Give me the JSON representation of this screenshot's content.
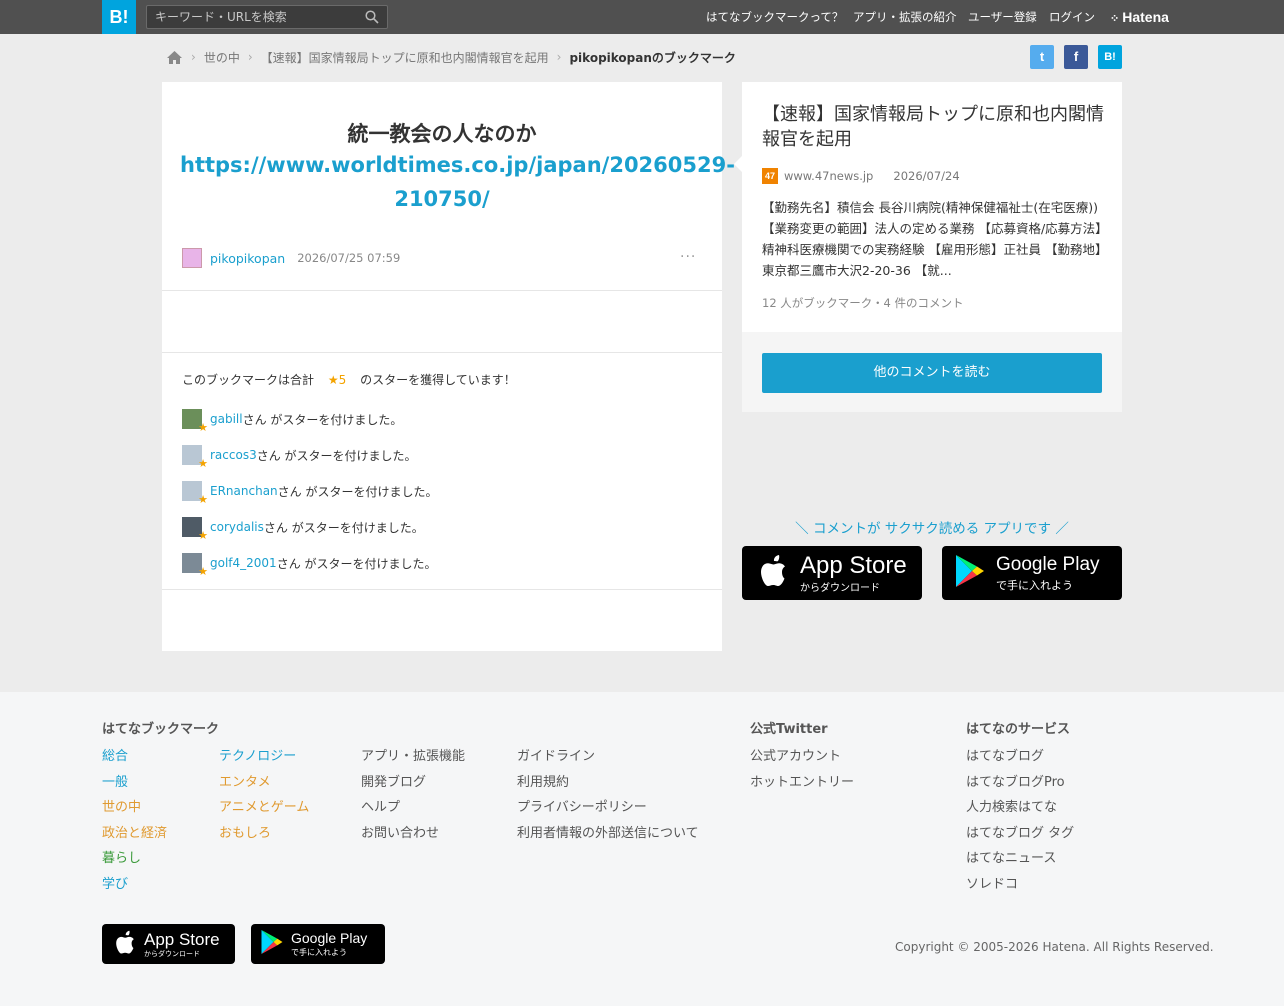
{
  "header": {
    "logo": "B!",
    "search_placeholder": "キーワード・URLを検索",
    "nav": [
      "はてなブックマークって？",
      "アプリ・拡張の紹介",
      "ユーザー登録",
      "ログイン"
    ],
    "brand": "Hatena"
  },
  "breadcrumb": {
    "items": [
      "世の中",
      "【速報】国家情報局トップに原和也内閣情報官を起用",
      "pikopikopanのブックマーク"
    ]
  },
  "share": {
    "twitter": "t",
    "facebook": "f",
    "hatena": "B!"
  },
  "comment": {
    "title": "統一教会の人なのか",
    "link": "https://www.worldtimes.co.jp/japan/20260529-210750/",
    "user": "pikopikopan",
    "date": "2026/07/25 07:59",
    "more": "···"
  },
  "stars": {
    "summary_prefix": "このブックマークは合計",
    "summary_count": "★5",
    "summary_suffix": "のスターを獲得しています！",
    "suffix": "さん がスターを付けました。",
    "entries": [
      {
        "user": "gabill"
      },
      {
        "user": "raccos3"
      },
      {
        "user": "ERnanchan"
      },
      {
        "user": "corydalis"
      },
      {
        "user": "golf4_2001"
      }
    ]
  },
  "entry": {
    "title": "【速報】国家情報局トップに原和也内閣情報官を起用",
    "favicon": "47",
    "domain": "www.47news.jp",
    "date": "2026/07/24",
    "summary": "【勤務先名】積信会 長谷川病院(精神保健福祉士(在宅医療))【業務変更の範囲】法人の定める業務 【応募資格/応募方法】精神科医療機関での実務経験 【雇用形態】正社員 【勤務地】東京都三鷹市大沢2-20-36 【就...",
    "meta": "12 人がブックマーク・4 件のコメント",
    "read_more": "他のコメントを読む"
  },
  "app_promo": {
    "tagline": "＼ コメントが サクサク読める アプリです ／",
    "appstore_main": "App Store",
    "appstore_sub": "からダウンロード",
    "googleplay_main": "Google Play",
    "googleplay_sub": "で手に入れよう"
  },
  "footer": {
    "bookmark_heading": "はてなブックマーク",
    "twitter_heading": "公式Twitter",
    "services_heading": "はてなのサービス",
    "col1": [
      "総合",
      "一般",
      "世の中",
      "政治と経済",
      "暮らし",
      "学び"
    ],
    "col2": [
      "テクノロジー",
      "エンタメ",
      "アニメとゲーム",
      "おもしろ"
    ],
    "col3": [
      "アプリ・拡張機能",
      "開発ブログ",
      "ヘルプ",
      "お問い合わせ"
    ],
    "col4": [
      "ガイドライン",
      "利用規約",
      "プライバシーポリシー",
      "利用者情報の外部送信について"
    ],
    "twitter": [
      "公式アカウント",
      "ホットエントリー"
    ],
    "services": [
      "はてなブログ",
      "はてなブログPro",
      "人力検索はてな",
      "はてなブログ タグ",
      "はてなニュース",
      "ソレドコ"
    ],
    "copyright": "Copyright © 2005-2026 Hatena. All Rights Reserved."
  },
  "colors": {
    "accent": "#1a9fce",
    "brand_blue": "#00a4de",
    "star": "#f4a300",
    "topbar": "#505050"
  }
}
